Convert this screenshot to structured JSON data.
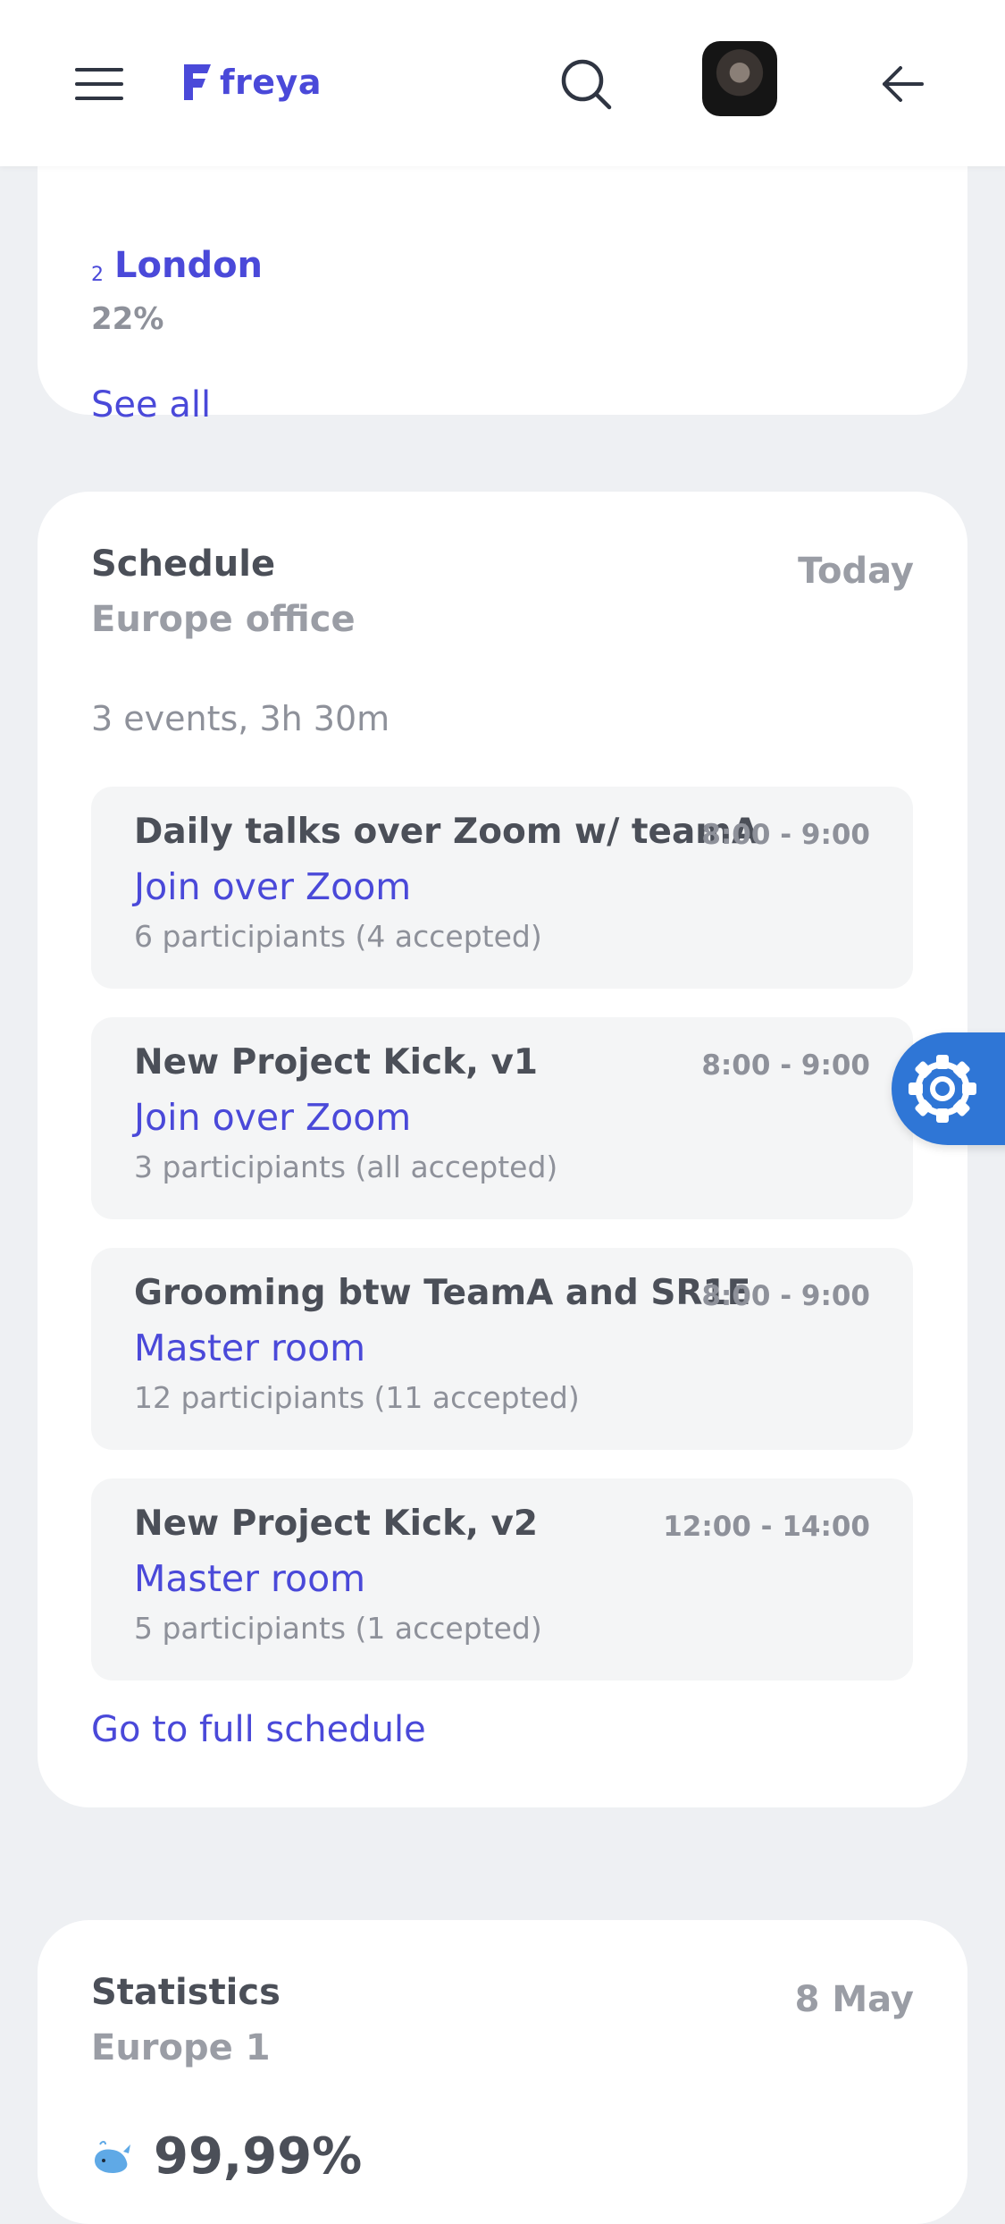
{
  "header": {
    "logo_text": "freya",
    "logo_color": "#4a49d9"
  },
  "top_card": {
    "rank": "2",
    "city": "London",
    "percent": "22%",
    "see_all": "See all"
  },
  "schedule": {
    "title": "Schedule",
    "subtitle": "Europe office",
    "date": "Today",
    "summary": "3 events, 3h 30m",
    "events": [
      {
        "title": "Daily talks over Zoom w/ teamA",
        "time": "8:00 - 9:00",
        "location": "Join over Zoom",
        "participants": "6 participiants (4 accepted)"
      },
      {
        "title": "New Project Kick, v1",
        "time": "8:00 - 9:00",
        "location": "Join over Zoom",
        "participants": "3 participiants (all accepted)"
      },
      {
        "title": "Grooming btw TeamA and SR1E",
        "time": "8:00 - 9:00",
        "location": "Master room",
        "participants": "12 participiants (11 accepted)"
      },
      {
        "title": "New Project Kick, v2",
        "time": "12:00 - 14:00",
        "location": "Master room",
        "participants": "5 participiants (1 accepted)"
      }
    ],
    "full_link": "Go to full schedule"
  },
  "statistics": {
    "title": "Statistics",
    "subtitle": "Europe 1",
    "date": "8 May",
    "value": "99,99%",
    "icon": "whale-icon"
  },
  "fab": {
    "icon": "gear-icon",
    "color": "#2f76d6"
  }
}
